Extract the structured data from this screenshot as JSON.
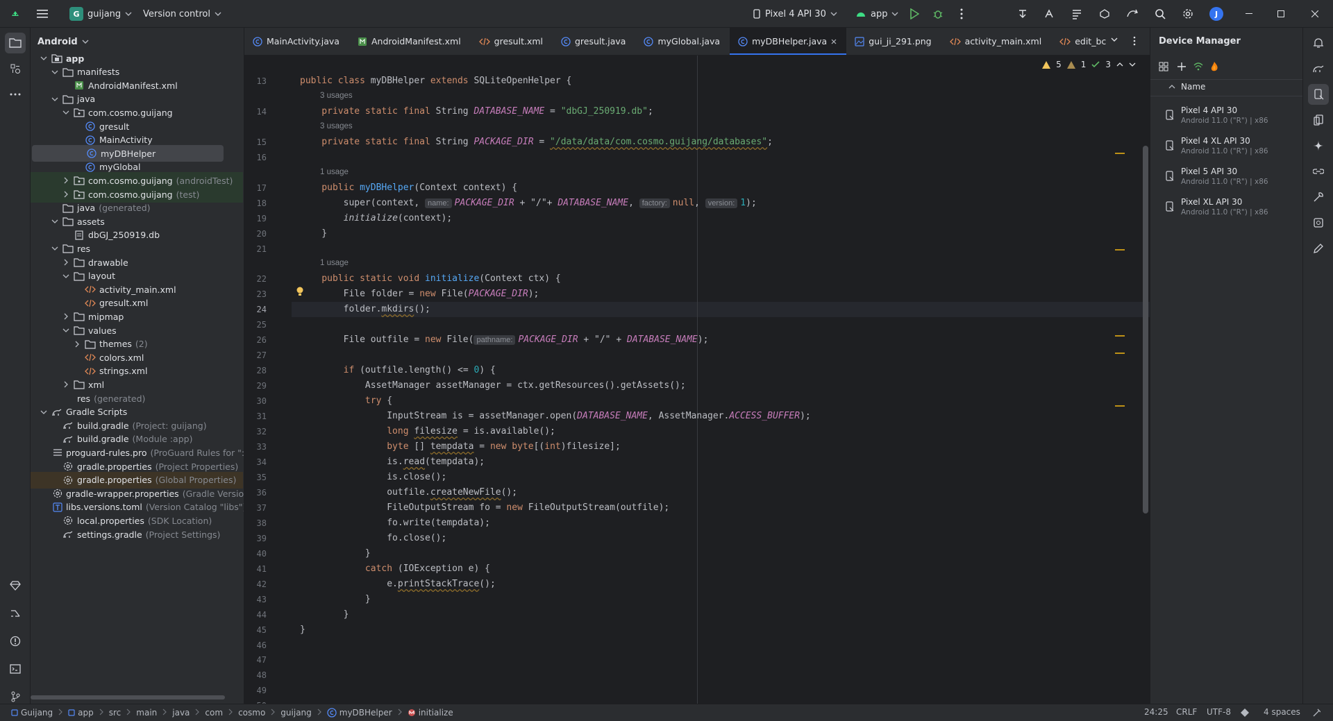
{
  "titlebar": {
    "project_initial": "G",
    "project_name": "guijang",
    "vcs_label": "Version control",
    "device_label": "Pixel 4 API 30",
    "run_config": "app",
    "avatar_initial": "J"
  },
  "project_panel": {
    "view_mode": "Android",
    "tree": [
      {
        "label": "app",
        "hint": "",
        "depth": 0,
        "chev": "down",
        "icon": "folder-module",
        "bold": true
      },
      {
        "label": "manifests",
        "hint": "",
        "depth": 1,
        "chev": "down",
        "icon": "folder"
      },
      {
        "label": "AndroidManifest.xml",
        "hint": "",
        "depth": 2,
        "chev": "",
        "icon": "manifest"
      },
      {
        "label": "java",
        "hint": "",
        "depth": 1,
        "chev": "down",
        "icon": "folder"
      },
      {
        "label": "com.cosmo.guijang",
        "hint": "",
        "depth": 2,
        "chev": "down",
        "icon": "package"
      },
      {
        "label": "gresult",
        "hint": "",
        "depth": 3,
        "chev": "",
        "icon": "class"
      },
      {
        "label": "MainActivity",
        "hint": "",
        "depth": 3,
        "chev": "",
        "icon": "class"
      },
      {
        "label": "myDBHelper",
        "hint": "",
        "depth": 3,
        "chev": "",
        "icon": "class",
        "selected": true
      },
      {
        "label": "myGlobal",
        "hint": "",
        "depth": 3,
        "chev": "",
        "icon": "class"
      },
      {
        "label": "com.cosmo.guijang",
        "hint": "(androidTest)",
        "depth": 2,
        "chev": "right",
        "icon": "package",
        "green": true
      },
      {
        "label": "com.cosmo.guijang",
        "hint": "(test)",
        "depth": 2,
        "chev": "right",
        "icon": "package",
        "green": true
      },
      {
        "label": "java",
        "hint": "(generated)",
        "depth": 1,
        "chev": "",
        "icon": "folder"
      },
      {
        "label": "assets",
        "hint": "",
        "depth": 1,
        "chev": "down",
        "icon": "folder"
      },
      {
        "label": "dbGJ_250919.db",
        "hint": "",
        "depth": 2,
        "chev": "",
        "icon": "file"
      },
      {
        "label": "res",
        "hint": "",
        "depth": 1,
        "chev": "down",
        "icon": "folder"
      },
      {
        "label": "drawable",
        "hint": "",
        "depth": 2,
        "chev": "right",
        "icon": "folder"
      },
      {
        "label": "layout",
        "hint": "",
        "depth": 2,
        "chev": "down",
        "icon": "folder"
      },
      {
        "label": "activity_main.xml",
        "hint": "",
        "depth": 3,
        "chev": "",
        "icon": "xml"
      },
      {
        "label": "gresult.xml",
        "hint": "",
        "depth": 3,
        "chev": "",
        "icon": "xml"
      },
      {
        "label": "mipmap",
        "hint": "",
        "depth": 2,
        "chev": "right",
        "icon": "folder"
      },
      {
        "label": "values",
        "hint": "",
        "depth": 2,
        "chev": "down",
        "icon": "folder"
      },
      {
        "label": "themes",
        "hint": "(2)",
        "depth": 3,
        "chev": "right",
        "icon": "folder"
      },
      {
        "label": "colors.xml",
        "hint": "",
        "depth": 3,
        "chev": "",
        "icon": "xml"
      },
      {
        "label": "strings.xml",
        "hint": "",
        "depth": 3,
        "chev": "",
        "icon": "xml"
      },
      {
        "label": "xml",
        "hint": "",
        "depth": 2,
        "chev": "right",
        "icon": "folder"
      },
      {
        "label": "res",
        "hint": "(generated)",
        "depth": 1,
        "chev": "",
        "icon": "none"
      },
      {
        "label": "Gradle Scripts",
        "hint": "",
        "depth": 0,
        "chev": "down",
        "icon": "gradle"
      },
      {
        "label": "build.gradle",
        "hint": "(Project: guijang)",
        "depth": 1,
        "chev": "",
        "icon": "gradle"
      },
      {
        "label": "build.gradle",
        "hint": "(Module :app)",
        "depth": 1,
        "chev": "",
        "icon": "gradle"
      },
      {
        "label": "proguard-rules.pro",
        "hint": "(ProGuard Rules for \":app",
        "depth": 1,
        "chev": "",
        "icon": "lines"
      },
      {
        "label": "gradle.properties",
        "hint": "(Project Properties)",
        "depth": 1,
        "chev": "",
        "icon": "gear"
      },
      {
        "label": "gradle.properties",
        "hint": "(Global Properties)",
        "depth": 1,
        "chev": "",
        "icon": "gear",
        "orange": true
      },
      {
        "label": "gradle-wrapper.properties",
        "hint": "(Gradle Version)",
        "depth": 1,
        "chev": "",
        "icon": "gear"
      },
      {
        "label": "libs.versions.toml",
        "hint": "(Version Catalog \"libs\")",
        "depth": 1,
        "chev": "",
        "icon": "toml"
      },
      {
        "label": "local.properties",
        "hint": "(SDK Location)",
        "depth": 1,
        "chev": "",
        "icon": "gear"
      },
      {
        "label": "settings.gradle",
        "hint": "(Project Settings)",
        "depth": 1,
        "chev": "",
        "icon": "gradle"
      }
    ]
  },
  "tabs": [
    {
      "label": "MainActivity.java",
      "icon": "class"
    },
    {
      "label": "AndroidManifest.xml",
      "icon": "manifest"
    },
    {
      "label": "gresult.xml",
      "icon": "xml"
    },
    {
      "label": "gresult.java",
      "icon": "class"
    },
    {
      "label": "myGlobal.java",
      "icon": "class"
    },
    {
      "label": "myDBHelper.java",
      "icon": "class",
      "active": true
    },
    {
      "label": "gui_ji_291.png",
      "icon": "image"
    },
    {
      "label": "activity_main.xml",
      "icon": "xml"
    },
    {
      "label": "edit_bc",
      "icon": "xml"
    }
  ],
  "inspections": {
    "warnings": "5",
    "weak": "1",
    "ok": "3"
  },
  "line_numbers": [
    "13",
    "14",
    "15",
    "16",
    "17",
    "18",
    "19",
    "20",
    "21",
    "22",
    "23",
    "24",
    "25",
    "26",
    "27",
    "28",
    "29",
    "30",
    "31",
    "32",
    "33",
    "34",
    "35",
    "36",
    "37",
    "38",
    "39",
    "40",
    "41",
    "42",
    "43",
    "44",
    "45",
    "46",
    "47",
    "48",
    "49",
    "50"
  ],
  "current_line": "24",
  "usages": {
    "u1": "3 usages",
    "u2": "3 usages",
    "u3": "1 usage",
    "u4": "1 usage"
  },
  "code": {
    "l13": {
      "a": "public class ",
      "b": "myDBHelper ",
      "c": "extends ",
      "d": "SQLiteOpenHelper {"
    },
    "l14": {
      "a": "    private static final ",
      "b": "String ",
      "c": "DATABASE_NAME",
      "d": " = ",
      "e": "\"dbGJ_250919.db\"",
      "f": ";"
    },
    "l15": {
      "a": "    private static final ",
      "b": "String ",
      "c": "PACKAGE_DIR",
      "d": " = ",
      "e": "\"/data/data/com.cosmo.guijang/databases\"",
      "f": ";"
    },
    "l17": {
      "a": "    public ",
      "b": "myDBHelper",
      "c": "(Context context) {"
    },
    "l18": {
      "a": "        super(context, ",
      "hint1": "name:",
      "b": "PACKAGE_DIR",
      "c": " + \"/\"+ ",
      "d": "DATABASE_NAME",
      "e": ", ",
      "hint2": "factory:",
      "f": "null",
      "g": ", ",
      "hint3": "version:",
      "h": "1",
      "i": ");"
    },
    "l19": {
      "a": "        ",
      "b": "initialize",
      "c": "(context);"
    },
    "l20": {
      "a": "    }"
    },
    "l22": {
      "a": "    public static void ",
      "b": "initialize",
      "c": "(Context ctx) {"
    },
    "l23": {
      "a": "        File folder = ",
      "b": "new ",
      "c": "File(",
      "d": "PACKAGE_DIR",
      "e": ");"
    },
    "l24": {
      "a": "        folder.",
      "b": "mkdirs",
      "c": "();"
    },
    "l26": {
      "a": "        File outfile = ",
      "b": "new ",
      "c": "File(",
      "hint1": "pathname:",
      "d": "PACKAGE_DIR",
      "e": " + \"/\" + ",
      "f": "DATABASE_NAME",
      "g": ");"
    },
    "l28": {
      "a": "        ",
      "b": "if ",
      "c": "(outfile.length() <= ",
      "d": "0",
      "e": ") {"
    },
    "l29": {
      "a": "            AssetManager assetManager = ctx.getResources().getAssets();"
    },
    "l30": {
      "a": "            ",
      "b": "try ",
      "c": "{"
    },
    "l31": {
      "a": "                InputStream is = assetManager.open(",
      "b": "DATABASE_NAME",
      "c": ", AssetManager.",
      "d": "ACCESS_BUFFER",
      "e": ");"
    },
    "l32": {
      "a": "                ",
      "b": "long ",
      "c": "filesize",
      "d": " = is.available();"
    },
    "l33": {
      "a": "                ",
      "b": "byte ",
      "c": "[] ",
      "d": "tempdata",
      "e": " = ",
      "f": "new byte",
      "g": "[(",
      "h": "int",
      "i": ")filesize];"
    },
    "l34": {
      "a": "                is.",
      "b": "read",
      "c": "(tempdata);"
    },
    "l35": {
      "a": "                is.close();"
    },
    "l36": {
      "a": "                outfile.",
      "b": "createNewFile",
      "c": "();"
    },
    "l37": {
      "a": "                FileOutputStream fo = ",
      "b": "new ",
      "c": "FileOutputStream(outfile);"
    },
    "l38": {
      "a": "                fo.write(tempdata);"
    },
    "l39": {
      "a": "                fo.close();"
    },
    "l40": {
      "a": "            }"
    },
    "l41": {
      "a": "            ",
      "b": "catch ",
      "c": "(IOException e) {"
    },
    "l42": {
      "a": "                e.",
      "b": "printStackTrace",
      "c": "();"
    },
    "l43": {
      "a": "            }"
    },
    "l44": {
      "a": "        }"
    },
    "l45": {
      "a": "}"
    }
  },
  "device_manager": {
    "title": "Device Manager",
    "column": "Name",
    "devices": [
      {
        "name": "Pixel 4 API 30",
        "sub": "Android 11.0 (\"R\") | x86"
      },
      {
        "name": "Pixel 4 XL API 30",
        "sub": "Android 11.0 (\"R\") | x86"
      },
      {
        "name": "Pixel 5 API 30",
        "sub": "Android 11.0 (\"R\") | x86"
      },
      {
        "name": "Pixel XL API 30",
        "sub": "Android 11.0 (\"R\") | x86"
      }
    ]
  },
  "statusbar": {
    "crumbs": [
      "Guijang",
      "app",
      "src",
      "main",
      "java",
      "com",
      "cosmo",
      "guijang",
      "myDBHelper",
      "initialize"
    ],
    "position": "24:25",
    "line_sep": "CRLF",
    "encoding": "UTF-8",
    "indent": "4 spaces"
  },
  "colors": {
    "accent": "#3574f0",
    "warning": "#be9117",
    "keyword": "#cf8e6d",
    "string": "#6aab73",
    "field": "#c77dbb",
    "function": "#56a8f5",
    "number": "#2aacb8"
  }
}
